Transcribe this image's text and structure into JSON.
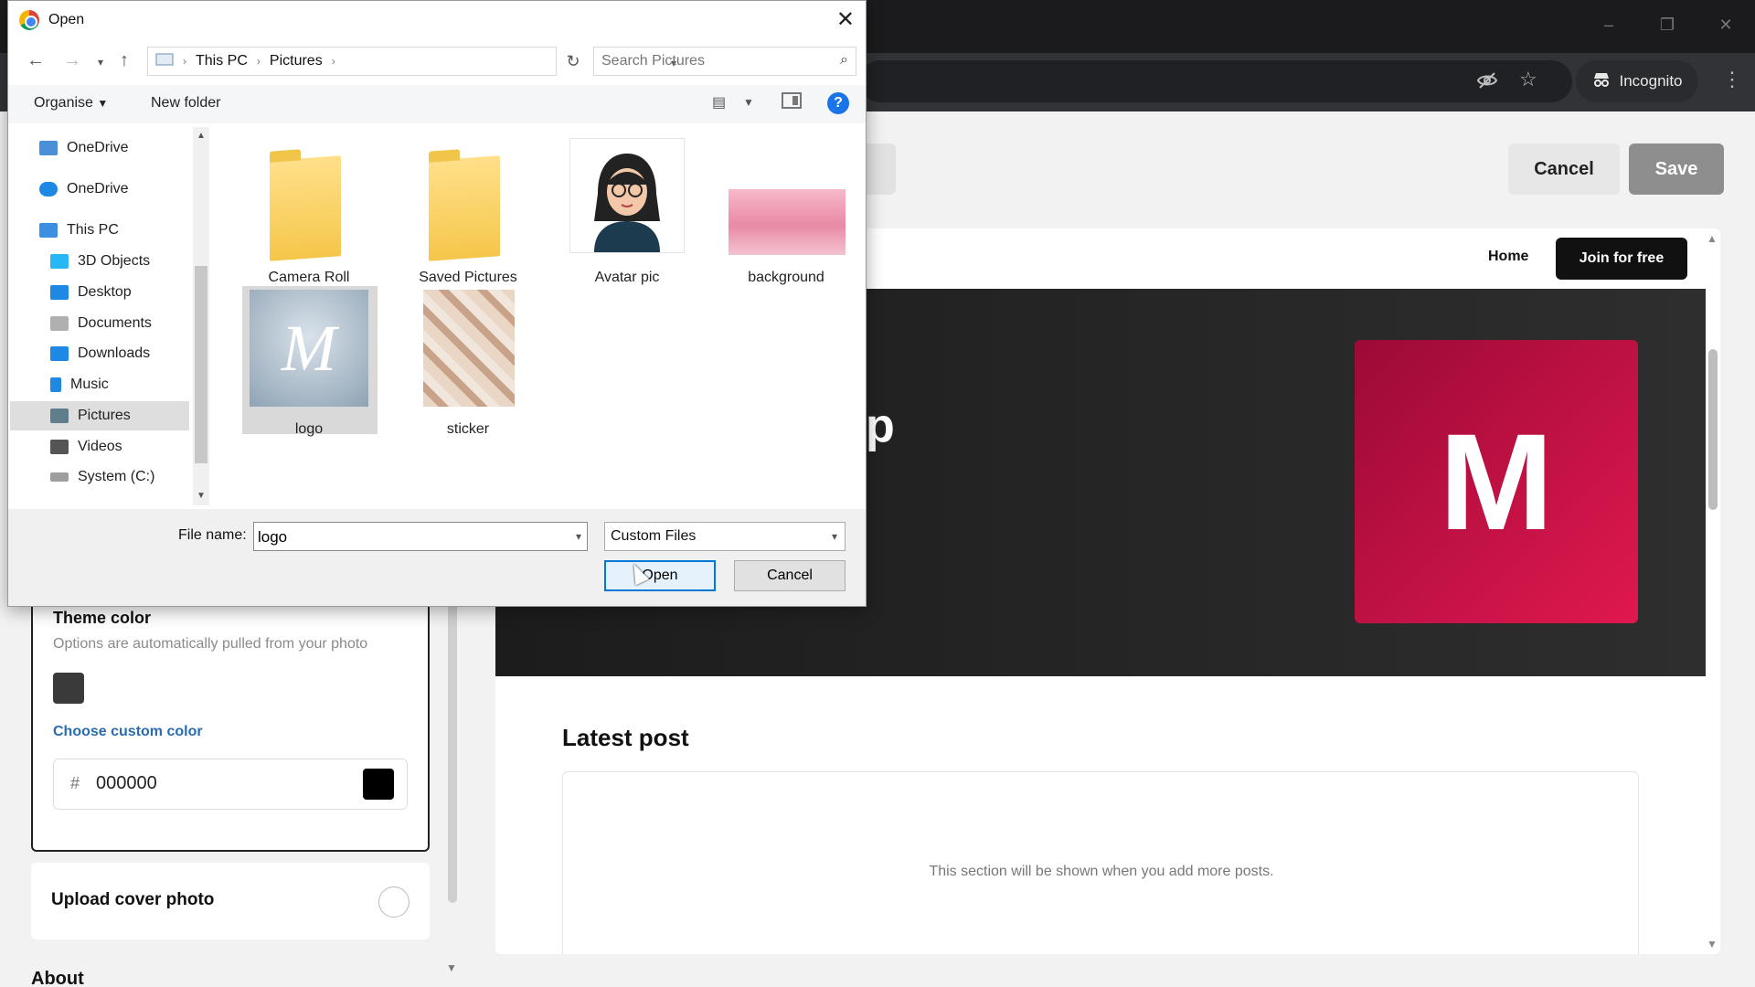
{
  "browser": {
    "incognito_label": "Incognito",
    "window_controls": [
      "–",
      "❐",
      "✕"
    ]
  },
  "page": {
    "cancel_label": "Cancel",
    "save_label": "Save",
    "theme": {
      "title": "Theme color",
      "subtitle": "Options are automatically pulled from your photo",
      "custom_link": "Choose custom color",
      "hash": "#",
      "hex_value": "000000"
    },
    "upload_cover_label": "Upload cover photo",
    "about_label": "About",
    "preview": {
      "nav_home": "Home",
      "nav_join": "Join for free",
      "hero_fragment": "p",
      "hero_logo_letter": "M",
      "latest_title": "Latest post",
      "latest_empty": "This section will be shown when you add more posts."
    }
  },
  "dialog": {
    "title": "Open",
    "breadcrumb": [
      "This PC",
      "Pictures"
    ],
    "search_placeholder": "Search Pictures",
    "organise_label": "Organise",
    "new_folder_label": "New folder",
    "help_glyph": "?",
    "tree": [
      {
        "label": "OneDrive",
        "icon": "onedrive-icon",
        "color": "#4a90d9"
      },
      {
        "label": "OneDrive",
        "icon": "cloud-icon",
        "color": "#1e88e5"
      },
      {
        "label": "This PC",
        "icon": "computer-icon",
        "color": "#3c8ee0"
      },
      {
        "label": "3D Objects",
        "icon": "cube-icon",
        "color": "#29b6f6"
      },
      {
        "label": "Desktop",
        "icon": "desktop-icon",
        "color": "#1e88e5"
      },
      {
        "label": "Documents",
        "icon": "document-icon",
        "color": "#9e9e9e"
      },
      {
        "label": "Downloads",
        "icon": "download-icon",
        "color": "#1e88e5"
      },
      {
        "label": "Music",
        "icon": "music-icon",
        "color": "#1e88e5"
      },
      {
        "label": "Pictures",
        "icon": "pictures-icon",
        "color": "#607d8b"
      },
      {
        "label": "Videos",
        "icon": "video-icon",
        "color": "#555555"
      },
      {
        "label": "System (C:)",
        "icon": "drive-icon",
        "color": "#9e9e9e"
      }
    ],
    "files": [
      {
        "label": "Camera Roll",
        "kind": "folder"
      },
      {
        "label": "Saved Pictures",
        "kind": "folder"
      },
      {
        "label": "Avatar pic",
        "kind": "image"
      },
      {
        "label": "background",
        "kind": "image"
      },
      {
        "label": "logo",
        "kind": "image"
      },
      {
        "label": "sticker",
        "kind": "image"
      }
    ],
    "file_name_label": "File name:",
    "file_name_value": "logo",
    "file_type": "Custom Files",
    "open_label": "Open",
    "cancel_label": "Cancel"
  },
  "colors": {
    "accent": "#0078d7",
    "hero_logo": "#d0134a",
    "link": "#2b6cb0"
  }
}
